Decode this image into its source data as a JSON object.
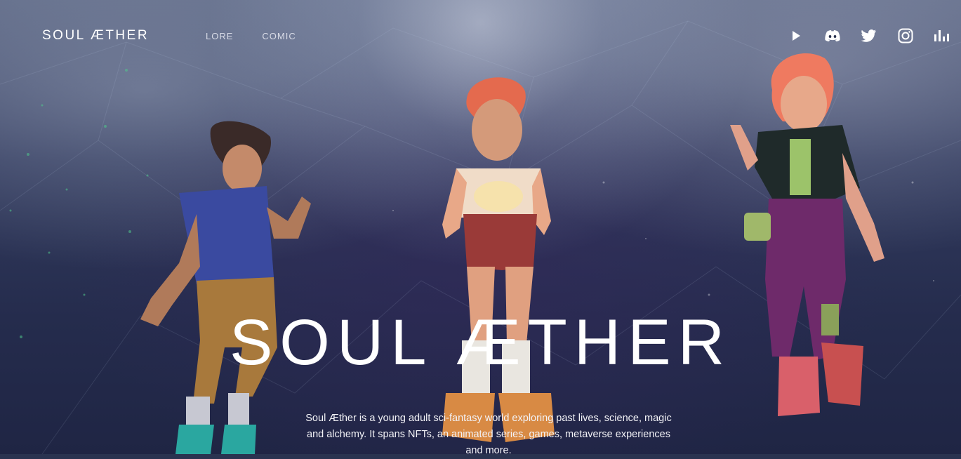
{
  "header": {
    "logo_text": "SOUL ÆTHER",
    "nav": [
      {
        "label": "LORE"
      },
      {
        "label": "COMIC"
      }
    ],
    "social": [
      {
        "icon": "play-icon"
      },
      {
        "icon": "discord-icon"
      },
      {
        "icon": "twitter-icon"
      },
      {
        "icon": "instagram-icon"
      },
      {
        "icon": "bar-chart-icon"
      }
    ]
  },
  "hero": {
    "title": "SOUL ÆTHER",
    "description": "Soul Æther is a young adult sci-fantasy world exploring past lives, science, magic and alchemy. It spans NFTs, an animated series, games, metaverse experiences and more."
  },
  "colors": {
    "background": "#2a3350",
    "accent_hair": "#e8735a",
    "text": "#ffffff"
  }
}
